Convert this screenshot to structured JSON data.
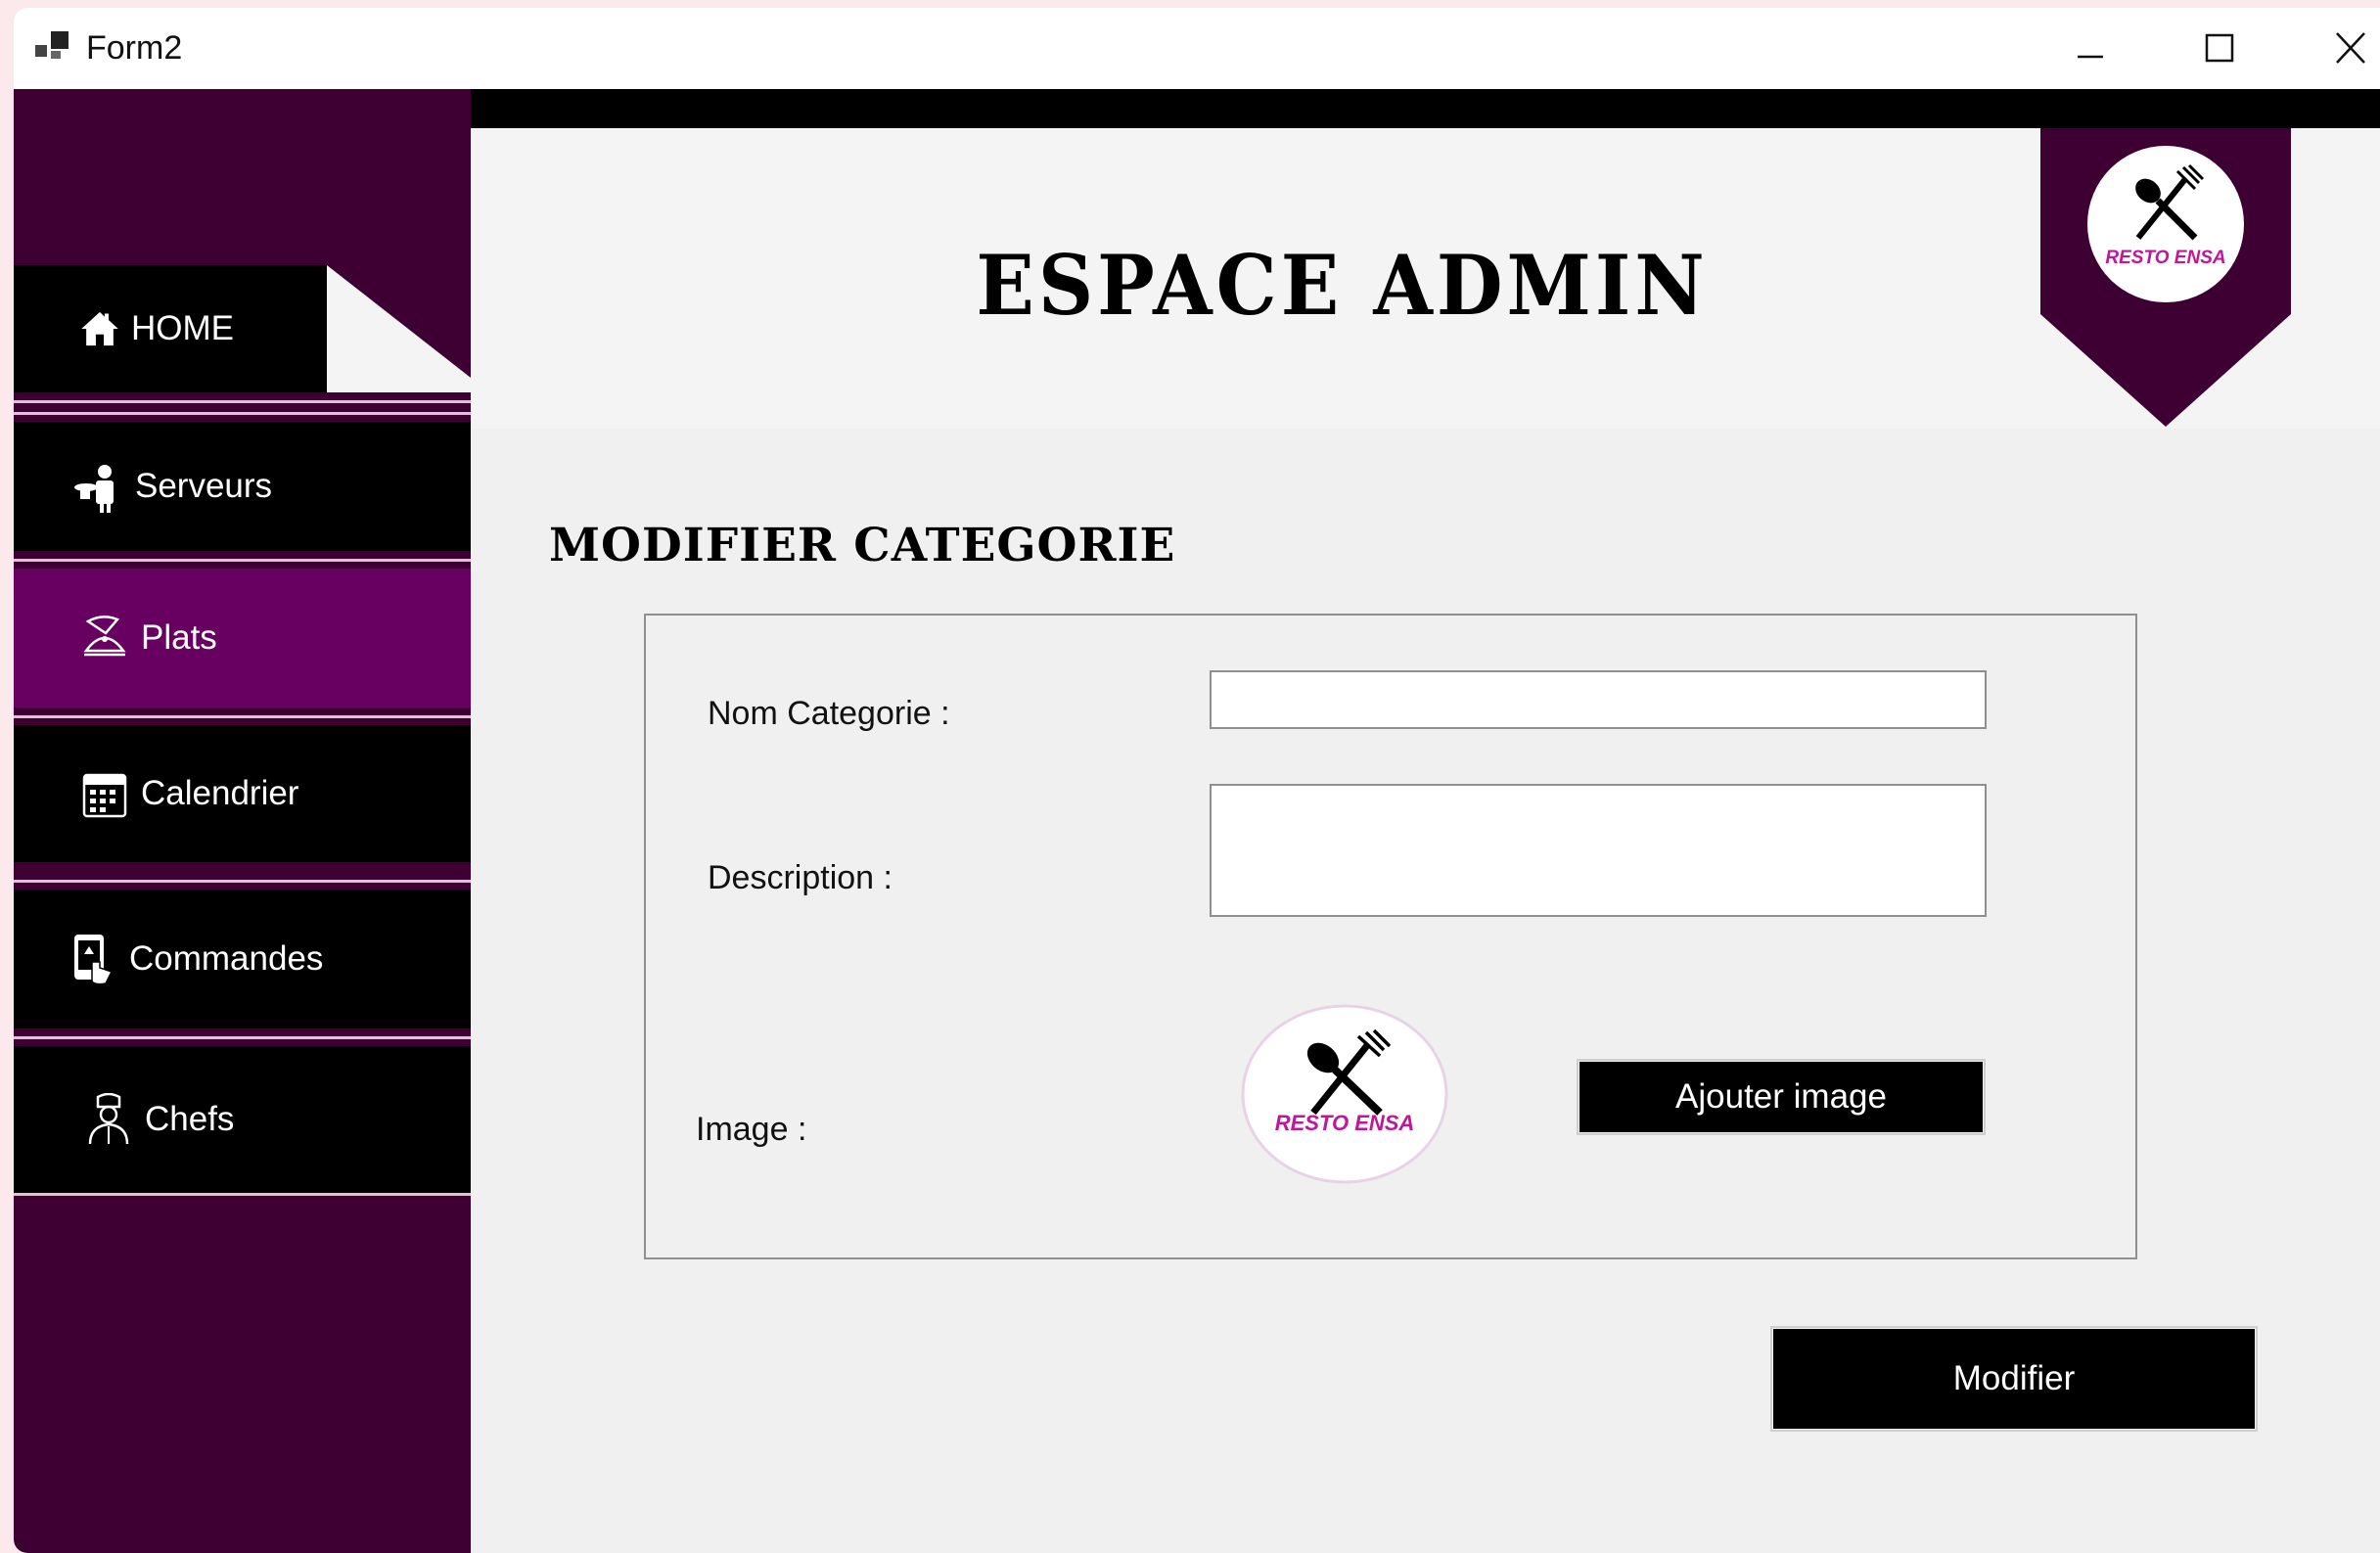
{
  "window": {
    "title": "Form2"
  },
  "sidebar": {
    "items": [
      {
        "label": "HOME",
        "icon": "home-icon"
      },
      {
        "label": "Serveurs",
        "icon": "waiter-icon"
      },
      {
        "label": "Plats",
        "icon": "cloche-icon",
        "active": true
      },
      {
        "label": "Calendrier",
        "icon": "calendar-icon"
      },
      {
        "label": "Commandes",
        "icon": "phone-order-icon"
      },
      {
        "label": "Chefs",
        "icon": "chef-icon"
      }
    ]
  },
  "header": {
    "title": "ESPACE ADMIN",
    "logo_text": "RESTO ENSA"
  },
  "form": {
    "section_title": "MODIFIER CATEGORIE",
    "name_label": "Nom Categorie :",
    "name_value": "",
    "description_label": "Description :",
    "description_value": "",
    "image_label": "Image :",
    "image_logo_text": "RESTO ENSA",
    "add_image_label": "Ajouter image",
    "submit_label": "Modifier"
  },
  "colors": {
    "sidebar_bg": "#3e0033",
    "active_item": "#670060",
    "nav_item": "#000000",
    "logo_text": "#c0169a"
  }
}
